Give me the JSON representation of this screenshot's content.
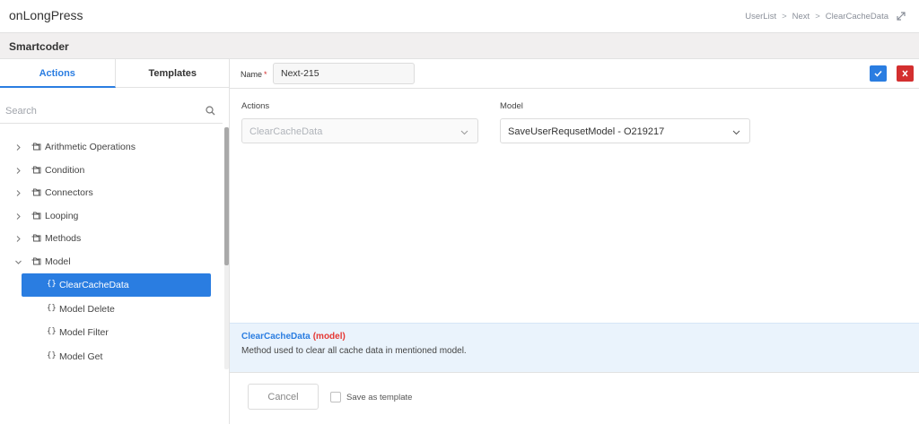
{
  "app": {
    "title": "onLongPress",
    "breadcrumb": [
      "UserList",
      "Next",
      "ClearCacheData"
    ],
    "breadcrumb_separator": ">",
    "expand_icon": "expand-icon"
  },
  "subheader": {
    "title": "Smartcoder"
  },
  "sidebar": {
    "tabs": [
      {
        "label": "Actions",
        "active": true
      },
      {
        "label": "Templates",
        "active": false
      }
    ],
    "search": {
      "placeholder": "Search",
      "value": ""
    },
    "tree": [
      {
        "label": "Arithmetic Operations",
        "expanded": false
      },
      {
        "label": "Condition",
        "expanded": false
      },
      {
        "label": "Connectors",
        "expanded": false
      },
      {
        "label": "Looping",
        "expanded": false
      },
      {
        "label": "Methods",
        "expanded": false
      },
      {
        "label": "Model",
        "expanded": true
      }
    ],
    "children": [
      {
        "label": "ClearCacheData",
        "selected": true
      },
      {
        "label": "Model Delete",
        "selected": false
      },
      {
        "label": "Model Filter",
        "selected": false
      },
      {
        "label": "Model Get",
        "selected": false
      }
    ],
    "brace_glyph": "{}"
  },
  "editor": {
    "name_label": "Name",
    "required_mark": "*",
    "name_value": "Next-215",
    "actions_label": "Actions",
    "actions_value": "ClearCacheData",
    "model_label": "Model",
    "model_value": "SaveUserRequsetModel - O219217"
  },
  "info": {
    "title": "ClearCacheData",
    "tag": "(model)",
    "description": "Method used to clear all cache data in mentioned model."
  },
  "footer": {
    "cancel_label": "Cancel",
    "save_template_label": "Save as template",
    "save_template_checked": false
  },
  "colors": {
    "accent": "#2a7de1",
    "danger": "#d32f2f",
    "info_bg": "#eaf3fc"
  }
}
